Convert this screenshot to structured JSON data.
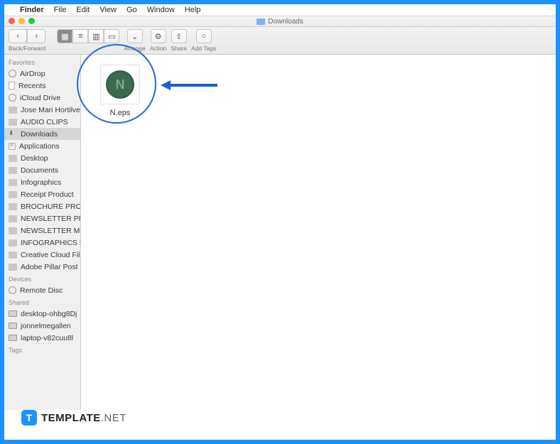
{
  "menubar": {
    "app": "Finder",
    "items": [
      "File",
      "Edit",
      "View",
      "Go",
      "Window",
      "Help"
    ]
  },
  "window": {
    "title": "Downloads"
  },
  "toolbar": {
    "nav_label": "Back/Forward",
    "arrange_label": "Arrange",
    "action_label": "Action",
    "share_label": "Share",
    "tags_label": "Add Tags"
  },
  "sidebar": {
    "sections": {
      "favorites": "Favorites",
      "devices": "Devices",
      "shared": "Shared",
      "tags": "Tags"
    },
    "favorites": [
      "AirDrop",
      "Recents",
      "iCloud Drive",
      "Jose Mari Hortilvero",
      "AUDIO CLIPS",
      "Downloads",
      "Applications",
      "Desktop",
      "Documents",
      "Infographics",
      "Receipt Product",
      "BROCHURE PRODU…",
      "NEWSLETTER PROD…",
      "NEWSLETTER MOC…",
      "INFOGRAPHICS PRO…",
      "Creative Cloud Files",
      "Adobe Pillar Post"
    ],
    "devices": [
      "Remote Disc"
    ],
    "shared": [
      "desktop-ohbg8Dj",
      "jonnelmegallen",
      "laptop-v82cuu8l"
    ]
  },
  "file": {
    "name": "N.eps",
    "glyph": "N"
  },
  "watermark": {
    "badge": "T",
    "brand": "TEMPLATE",
    "suffix": ".NET"
  }
}
